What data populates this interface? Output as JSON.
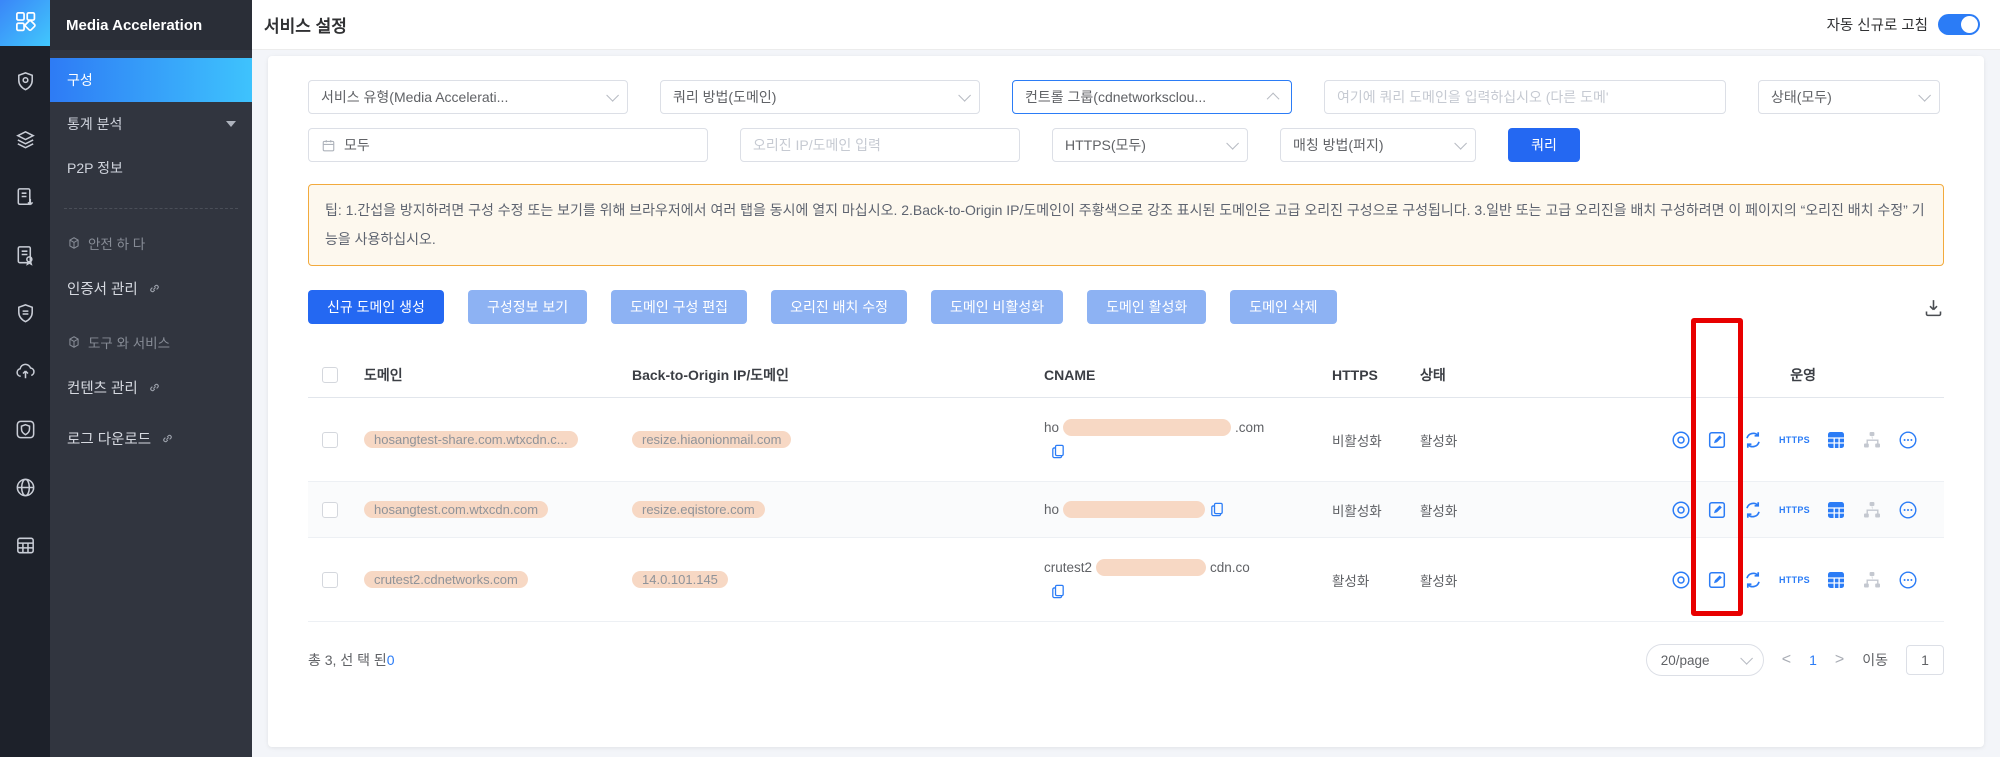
{
  "colors": {
    "accent": "#2468f2",
    "accent_soft": "#8db2f3",
    "tip_border": "#f2aa3d",
    "tip_bg": "#fdf8ee",
    "redaction": "#f7d8c4",
    "annotation_red": "#e80000",
    "toggle_on": "#2b7cf6",
    "sidebar_active_gradient": [
      "#2e7bf5",
      "#3ec3fd"
    ]
  },
  "sidebar": {
    "title": "Media Acceleration",
    "menu": [
      {
        "label": "구성"
      },
      {
        "label": "통계 분석"
      },
      {
        "label": "P2P 정보"
      }
    ],
    "sections": [
      {
        "label": "안전 하 다"
      },
      {
        "label": "도구 와 서비스"
      }
    ],
    "links": [
      {
        "label": "인증서 관리"
      },
      {
        "label": "컨텐츠 관리"
      },
      {
        "label": "로그 다운로드"
      }
    ]
  },
  "header": {
    "title": "서비스 설정",
    "auto_refresh_label": "자동 신규로 고침"
  },
  "filters": {
    "service_type": "서비스 유형(Media Accelerati...",
    "query_method": "쿼리 방법(도메인)",
    "control_group": "컨트롤 그룹(cdnetworksclou...",
    "domain_placeholder": "여기에 쿼리 도메인을 입력하십시오 (다른 도메'",
    "status": "상태(모두)",
    "date_value": "모두",
    "origin_placeholder": "오리진 IP/도메인 입력",
    "https": "HTTPS(모두)",
    "match_method": "매칭 방법(퍼지)",
    "query_button": "쿼리"
  },
  "tip": "팁: 1.간섭을 방지하려면 구성 수정 또는 보기를 위해 브라우저에서 여러 탭을 동시에 열지 마십시오. 2.Back-to-Origin IP/도메인이 주황색으로 강조 표시된 도메인은 고급 오리진 구성으로 구성됩니다. 3.일반 또는 고급 오리진을 배치 구성하려면 이 페이지의 “오리진 배치 수정” 기능을 사용하십시오.",
  "actions": {
    "primary": "신규 도메인 생성",
    "secondary": [
      "구성정보 보기",
      "도메인 구성 편집",
      "오리진 배치 수정",
      "도메인 비활성화",
      "도메인 활성화",
      "도메인 삭제"
    ]
  },
  "table": {
    "headers": {
      "domain": "도메인",
      "origin": "Back-to-Origin IP/도메인",
      "cname": "CNAME",
      "https": "HTTPS",
      "status": "상태",
      "ops": "운영"
    },
    "ops_https_label": "HTTPS",
    "rows": [
      {
        "domain": "hosangtest-share.com.wtxcdn.c...",
        "origin": "resize.hiaonionmail.com",
        "cname_pre": "ho",
        "cname_post": ".com",
        "https": "비활성화",
        "status": "활성화"
      },
      {
        "domain": "hosangtest.com.wtxcdn.com",
        "origin": "resize.eqistore.com",
        "cname_pre": "ho",
        "cname_post": "",
        "https": "비활성화",
        "status": "활성화"
      },
      {
        "domain": "crutest2.cdnetworks.com",
        "origin": "14.0.101.145",
        "cname_pre": "crutest2",
        "cname_post": "cdn.co",
        "https": "활성화",
        "status": "활성화"
      }
    ]
  },
  "footer": {
    "total_label": "총 3, 선 택 된",
    "selected_count": "0",
    "page_size": "20/page",
    "current_page": "1",
    "goto_label": "이동",
    "goto_value": "1"
  }
}
